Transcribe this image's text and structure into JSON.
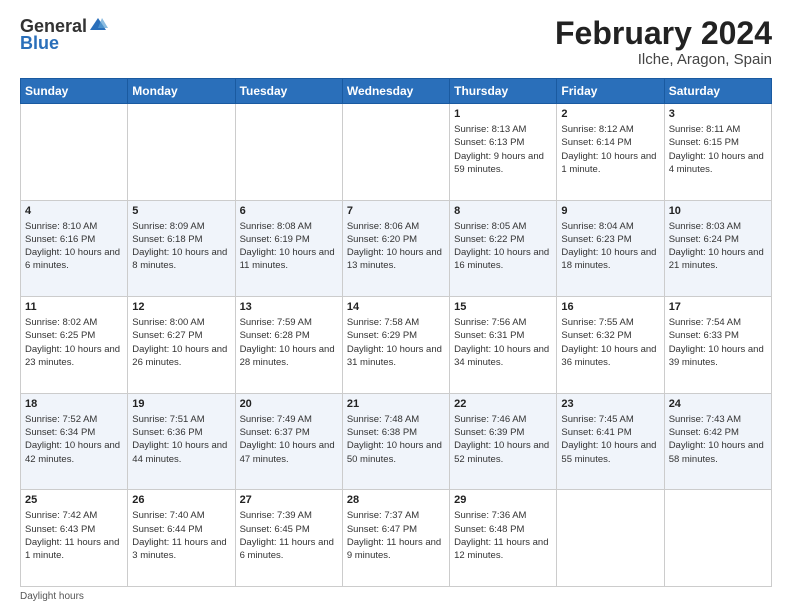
{
  "header": {
    "logo_general": "General",
    "logo_blue": "Blue",
    "title": "February 2024",
    "location": "Ilche, Aragon, Spain"
  },
  "days_of_week": [
    "Sunday",
    "Monday",
    "Tuesday",
    "Wednesday",
    "Thursday",
    "Friday",
    "Saturday"
  ],
  "weeks": [
    [
      {
        "day": "",
        "info": ""
      },
      {
        "day": "",
        "info": ""
      },
      {
        "day": "",
        "info": ""
      },
      {
        "day": "",
        "info": ""
      },
      {
        "day": "1",
        "info": "Sunrise: 8:13 AM\nSunset: 6:13 PM\nDaylight: 9 hours and 59 minutes."
      },
      {
        "day": "2",
        "info": "Sunrise: 8:12 AM\nSunset: 6:14 PM\nDaylight: 10 hours and 1 minute."
      },
      {
        "day": "3",
        "info": "Sunrise: 8:11 AM\nSunset: 6:15 PM\nDaylight: 10 hours and 4 minutes."
      }
    ],
    [
      {
        "day": "4",
        "info": "Sunrise: 8:10 AM\nSunset: 6:16 PM\nDaylight: 10 hours and 6 minutes."
      },
      {
        "day": "5",
        "info": "Sunrise: 8:09 AM\nSunset: 6:18 PM\nDaylight: 10 hours and 8 minutes."
      },
      {
        "day": "6",
        "info": "Sunrise: 8:08 AM\nSunset: 6:19 PM\nDaylight: 10 hours and 11 minutes."
      },
      {
        "day": "7",
        "info": "Sunrise: 8:06 AM\nSunset: 6:20 PM\nDaylight: 10 hours and 13 minutes."
      },
      {
        "day": "8",
        "info": "Sunrise: 8:05 AM\nSunset: 6:22 PM\nDaylight: 10 hours and 16 minutes."
      },
      {
        "day": "9",
        "info": "Sunrise: 8:04 AM\nSunset: 6:23 PM\nDaylight: 10 hours and 18 minutes."
      },
      {
        "day": "10",
        "info": "Sunrise: 8:03 AM\nSunset: 6:24 PM\nDaylight: 10 hours and 21 minutes."
      }
    ],
    [
      {
        "day": "11",
        "info": "Sunrise: 8:02 AM\nSunset: 6:25 PM\nDaylight: 10 hours and 23 minutes."
      },
      {
        "day": "12",
        "info": "Sunrise: 8:00 AM\nSunset: 6:27 PM\nDaylight: 10 hours and 26 minutes."
      },
      {
        "day": "13",
        "info": "Sunrise: 7:59 AM\nSunset: 6:28 PM\nDaylight: 10 hours and 28 minutes."
      },
      {
        "day": "14",
        "info": "Sunrise: 7:58 AM\nSunset: 6:29 PM\nDaylight: 10 hours and 31 minutes."
      },
      {
        "day": "15",
        "info": "Sunrise: 7:56 AM\nSunset: 6:31 PM\nDaylight: 10 hours and 34 minutes."
      },
      {
        "day": "16",
        "info": "Sunrise: 7:55 AM\nSunset: 6:32 PM\nDaylight: 10 hours and 36 minutes."
      },
      {
        "day": "17",
        "info": "Sunrise: 7:54 AM\nSunset: 6:33 PM\nDaylight: 10 hours and 39 minutes."
      }
    ],
    [
      {
        "day": "18",
        "info": "Sunrise: 7:52 AM\nSunset: 6:34 PM\nDaylight: 10 hours and 42 minutes."
      },
      {
        "day": "19",
        "info": "Sunrise: 7:51 AM\nSunset: 6:36 PM\nDaylight: 10 hours and 44 minutes."
      },
      {
        "day": "20",
        "info": "Sunrise: 7:49 AM\nSunset: 6:37 PM\nDaylight: 10 hours and 47 minutes."
      },
      {
        "day": "21",
        "info": "Sunrise: 7:48 AM\nSunset: 6:38 PM\nDaylight: 10 hours and 50 minutes."
      },
      {
        "day": "22",
        "info": "Sunrise: 7:46 AM\nSunset: 6:39 PM\nDaylight: 10 hours and 52 minutes."
      },
      {
        "day": "23",
        "info": "Sunrise: 7:45 AM\nSunset: 6:41 PM\nDaylight: 10 hours and 55 minutes."
      },
      {
        "day": "24",
        "info": "Sunrise: 7:43 AM\nSunset: 6:42 PM\nDaylight: 10 hours and 58 minutes."
      }
    ],
    [
      {
        "day": "25",
        "info": "Sunrise: 7:42 AM\nSunset: 6:43 PM\nDaylight: 11 hours and 1 minute."
      },
      {
        "day": "26",
        "info": "Sunrise: 7:40 AM\nSunset: 6:44 PM\nDaylight: 11 hours and 3 minutes."
      },
      {
        "day": "27",
        "info": "Sunrise: 7:39 AM\nSunset: 6:45 PM\nDaylight: 11 hours and 6 minutes."
      },
      {
        "day": "28",
        "info": "Sunrise: 7:37 AM\nSunset: 6:47 PM\nDaylight: 11 hours and 9 minutes."
      },
      {
        "day": "29",
        "info": "Sunrise: 7:36 AM\nSunset: 6:48 PM\nDaylight: 11 hours and 12 minutes."
      },
      {
        "day": "",
        "info": ""
      },
      {
        "day": "",
        "info": ""
      }
    ]
  ],
  "footer": {
    "note": "Daylight hours"
  }
}
